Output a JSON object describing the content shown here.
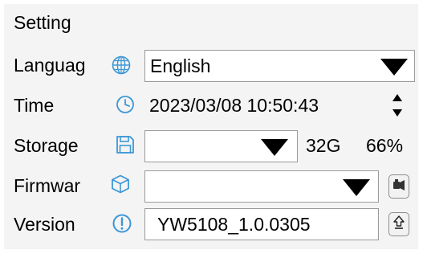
{
  "panel": {
    "title": "Setting"
  },
  "colors": {
    "accent_icon": "#3c97d6",
    "panel_bg": "#f4f4f4",
    "field_border": "#9a9a9a"
  },
  "rows": {
    "language": {
      "label": "Languag",
      "icon": "globe-icon",
      "value": "English"
    },
    "time": {
      "label": "Time",
      "icon": "clock-icon",
      "value": "2023/03/08 10:50:43",
      "control_icon": "up-down-spinner-icon"
    },
    "storage": {
      "label": "Storage",
      "icon": "floppy-disk-icon",
      "value": "",
      "capacity": "32G",
      "usage": "66%"
    },
    "firmware": {
      "label": "Firmwar",
      "icon": "cube-icon",
      "value": "",
      "button_icon": "flashlight-icon"
    },
    "version": {
      "label": "Version",
      "icon": "exclamation-icon",
      "value": "YW5108_1.0.0305",
      "button_icon": "upload-arrow-icon"
    }
  }
}
